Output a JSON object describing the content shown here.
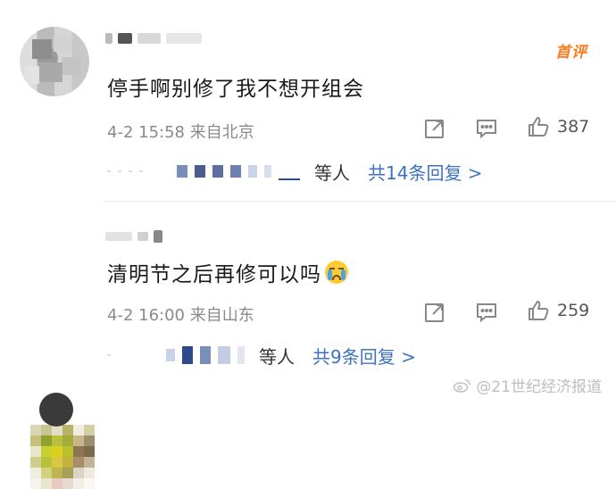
{
  "comments": [
    {
      "text": "停手啊别修了我不想开组会",
      "meta": "4-2 15:58 来自北京",
      "likes": "387",
      "badge": "首评",
      "reply_others": "等人",
      "reply_link": "共14条回复 >"
    },
    {
      "text": "清明节之后再修可以吗",
      "meta": "4-2 16:00 来自山东",
      "likes": "259",
      "reply_others": "等人",
      "reply_link": "共9条回复 >"
    }
  ],
  "icons": {
    "share": "share-icon",
    "comment": "comment-icon",
    "like": "thumbs-up-icon",
    "emoji": "crying-face-icon",
    "watermark": "weibo-icon"
  },
  "watermark": "@21世纪经济报道",
  "colors": {
    "badge": "#ff7a1a",
    "link": "#3d72c2",
    "meta": "#8a8a8a"
  }
}
